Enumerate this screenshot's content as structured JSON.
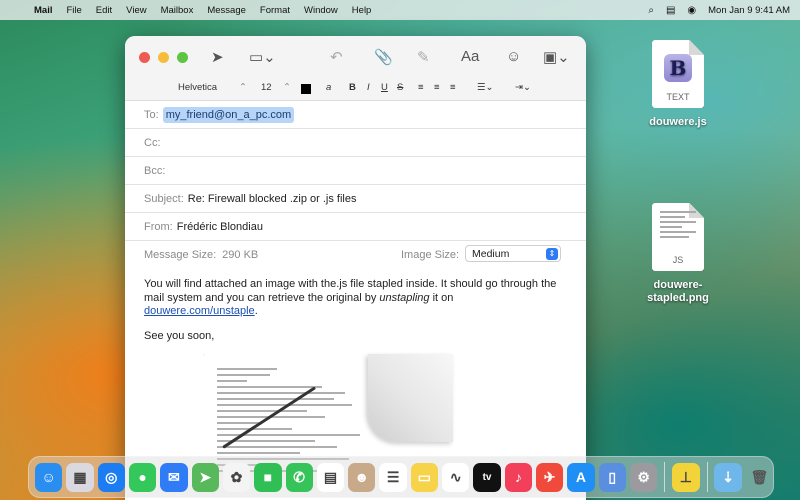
{
  "menubar": {
    "app": "Mail",
    "items": [
      "File",
      "Edit",
      "View",
      "Mailbox",
      "Message",
      "Format",
      "Window",
      "Help"
    ],
    "clock": "Mon Jan 9  9:41 AM"
  },
  "desktop": {
    "icon1": {
      "label": "douwere.js",
      "doc_text": "TEXT",
      "badge": "B"
    },
    "icon2": {
      "label": "douwere-\nstapled.png",
      "doc_text": "JS"
    }
  },
  "format": {
    "font": "Helvetica",
    "size": "12",
    "bold": "B",
    "italic": "I",
    "underline": "U",
    "strike": "S",
    "font_glyph": "Aa"
  },
  "compose": {
    "to_label": "To:",
    "to_value": "my_friend@on_a_pc.com",
    "cc_label": "Cc:",
    "bcc_label": "Bcc:",
    "subject_label": "Subject:",
    "subject_value": "Re: Firewall blocked .zip or .js files",
    "from_label": "From:",
    "from_value": "Frédéric Blondiau",
    "size_label": "Message Size:",
    "size_value": "290 KB",
    "image_size_label": "Image Size:",
    "image_size_value": "Medium"
  },
  "body": {
    "line1": "You will find attached an image with the.js file stapled inside. It should go through the mail system and you can retrieve the original by ",
    "emph": "unstapling",
    "line1_end": " it on ",
    "link": "douwere.com/unstaple",
    "period": ".",
    "closing": "See you soon,"
  },
  "dock": {
    "apps": [
      {
        "name": "finder",
        "color": "#2a8ef0",
        "glyph": "☺"
      },
      {
        "name": "launchpad",
        "color": "#d9d9df",
        "glyph": "▦"
      },
      {
        "name": "safari",
        "color": "#1c7cf2",
        "glyph": "◎"
      },
      {
        "name": "messages",
        "color": "#34c759",
        "glyph": "●"
      },
      {
        "name": "mail",
        "color": "#2f7cf6",
        "glyph": "✉"
      },
      {
        "name": "maps",
        "color": "#58b85c",
        "glyph": "➤"
      },
      {
        "name": "photos",
        "color": "#f4f4f4",
        "glyph": "✿"
      },
      {
        "name": "facetime",
        "color": "#2fbf55",
        "glyph": "■"
      },
      {
        "name": "phone",
        "color": "#36c45a",
        "glyph": "✆"
      },
      {
        "name": "calendar",
        "color": "#ffffff",
        "glyph": "▤"
      },
      {
        "name": "contacts",
        "color": "#c8a98a",
        "glyph": "☻"
      },
      {
        "name": "reminders",
        "color": "#ffffff",
        "glyph": "☰"
      },
      {
        "name": "notes",
        "color": "#f7d34a",
        "glyph": "▭"
      },
      {
        "name": "freeform",
        "color": "#ffffff",
        "glyph": "∿"
      },
      {
        "name": "tv",
        "color": "#111111",
        "glyph": "tv"
      },
      {
        "name": "music",
        "color": "#f2405b",
        "glyph": "♪"
      },
      {
        "name": "rocket",
        "color": "#f04a3c",
        "glyph": "✈"
      },
      {
        "name": "app-store",
        "color": "#1f8ff5",
        "glyph": "A"
      },
      {
        "name": "preview",
        "color": "#5a8fe0",
        "glyph": "▯"
      },
      {
        "name": "system-settings",
        "color": "#9a9a9f",
        "glyph": "⚙"
      },
      {
        "name": "stapler",
        "color": "#f2d43a",
        "glyph": "⊥"
      }
    ],
    "trash_glyph": "🗑"
  }
}
